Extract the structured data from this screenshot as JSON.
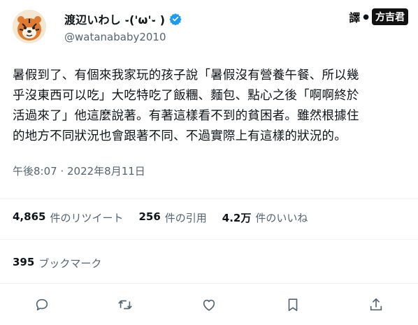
{
  "user": {
    "display_name": "渡辺いわし ֊('ω'֊ )",
    "handle": "@watanababy2010",
    "verified": true
  },
  "watermark": {
    "char1": "譯",
    "char2": "方吉君"
  },
  "tweet": {
    "text": "暑假到了、有個來我家玩的孩子說「暑假沒有營養午餐、所以幾\n乎沒東西可以吃」大吃特吃了飯糰、麵包、點心之後「啊啊終於\n活過來了」他這麼說著。有著這樣看不到的貧困者。雖然根據住\n的地方不同狀況也會跟著不同、不過實際上有這樣的狀況的。",
    "timestamp": "午後8:07 · 2022年8月11日"
  },
  "stats": {
    "retweets_num": "4,865",
    "retweets_label": "件のリツイート",
    "quotes_num": "256",
    "quotes_label": "件の引用",
    "likes_num": "4.2万",
    "likes_label": "件のいいね",
    "bookmarks_num": "395",
    "bookmarks_label": "ブックマーク"
  },
  "actions": [
    "reply-icon",
    "retweet-icon",
    "like-icon",
    "bookmark-icon",
    "share-icon"
  ],
  "colors": {
    "text": "#0f1419",
    "secondary": "#536471",
    "verified": "#1d9bf0",
    "divider": "#eff3f4"
  }
}
